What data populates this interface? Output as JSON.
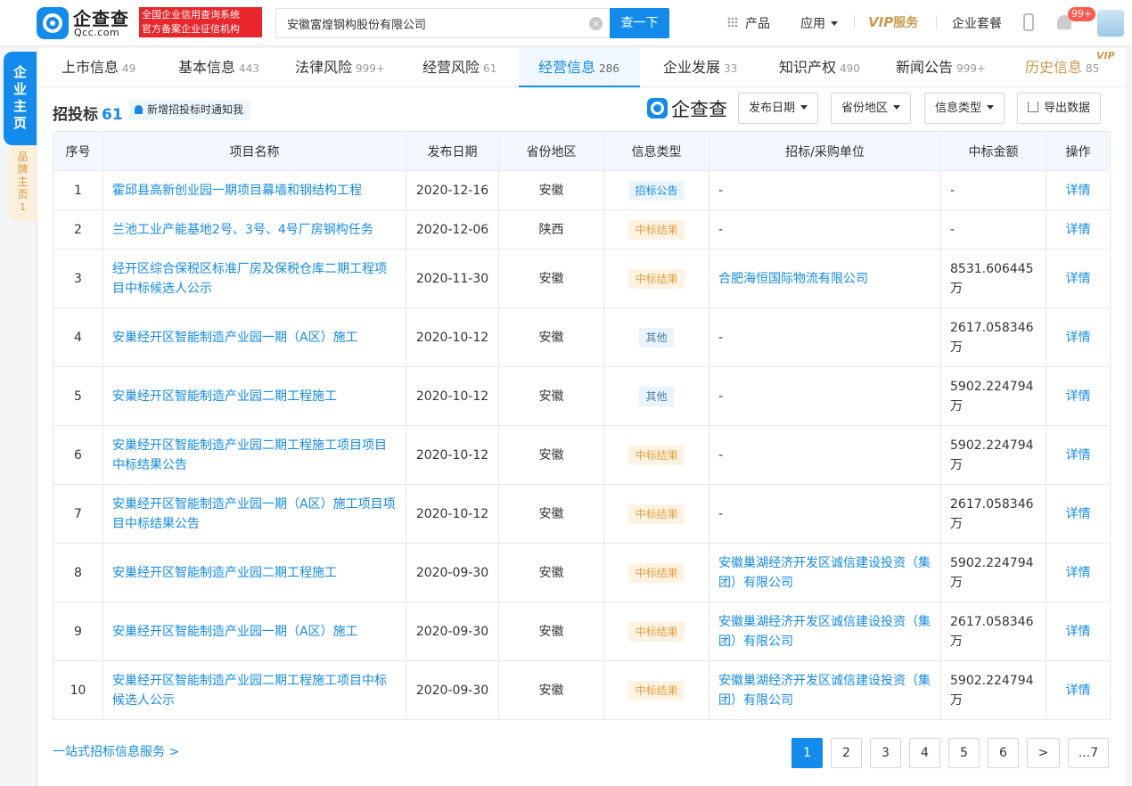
{
  "header": {
    "logo_name": "企查查",
    "logo_domain": "Qcc.com",
    "badge_line1": "全国企业信用查询系统",
    "badge_line2": "官方备案企业征信机构",
    "search_value": "安徽富煌钢构股份有限公司",
    "search_button": "查一下",
    "nav_products": "产品",
    "nav_apps": "应用",
    "nav_vip_text": "服务",
    "nav_vip_prefix": "VIP",
    "nav_package": "企业套餐",
    "notifications": "99+"
  },
  "side_tabs": {
    "main": "企业主页",
    "brand": "品牌主页",
    "brand_count": "1"
  },
  "tabs": [
    {
      "label": "上市信息",
      "count": "49"
    },
    {
      "label": "基本信息",
      "count": "443"
    },
    {
      "label": "法律风险",
      "count": "999+"
    },
    {
      "label": "经营风险",
      "count": "61"
    },
    {
      "label": "经营信息",
      "count": "286"
    },
    {
      "label": "企业发展",
      "count": "33"
    },
    {
      "label": "知识产权",
      "count": "490"
    },
    {
      "label": "新闻公告",
      "count": "999+"
    },
    {
      "label": "历史信息",
      "count": "85"
    }
  ],
  "history_vip": "VIP",
  "section": {
    "title": "招投标",
    "count": "61",
    "notify": "新增招投标时通知我",
    "brand": "企查查",
    "filters": [
      "发布日期",
      "省份地区",
      "信息类型"
    ],
    "export": "导出数据"
  },
  "table": {
    "headers": [
      "序号",
      "项目名称",
      "发布日期",
      "省份地区",
      "信息类型",
      "招标/采购单位",
      "中标金额",
      "操作"
    ],
    "rows": [
      {
        "no": "1",
        "name": "霍邱县高新创业园一期项目幕墙和钢结构工程",
        "date": "2020-12-16",
        "region": "安徽",
        "type": "招标公告",
        "unit": "-",
        "amount": "-",
        "action": "详情"
      },
      {
        "no": "2",
        "name": "兰池工业产能基地2号、3号、4号厂房钢构任务",
        "date": "2020-12-06",
        "region": "陕西",
        "type": "中标结果",
        "unit": "-",
        "amount": "-",
        "action": "详情"
      },
      {
        "no": "3",
        "name": "经开区综合保税区标准厂房及保税仓库二期工程项目中标候选人公示",
        "date": "2020-11-30",
        "region": "安徽",
        "type": "中标结果",
        "unit": "合肥海恒国际物流有限公司",
        "amount": "8531.606445万",
        "action": "详情"
      },
      {
        "no": "4",
        "name": "安巢经开区智能制造产业园一期（A区）施工",
        "date": "2020-10-12",
        "region": "安徽",
        "type": "其他",
        "unit": "-",
        "amount": "2617.058346万",
        "action": "详情"
      },
      {
        "no": "5",
        "name": "安巢经开区智能制造产业园二期工程施工",
        "date": "2020-10-12",
        "region": "安徽",
        "type": "其他",
        "unit": "-",
        "amount": "5902.224794万",
        "action": "详情"
      },
      {
        "no": "6",
        "name": "安巢经开区智能制造产业园二期工程施工项目项目中标结果公告",
        "date": "2020-10-12",
        "region": "安徽",
        "type": "中标结果",
        "unit": "-",
        "amount": "5902.224794万",
        "action": "详情"
      },
      {
        "no": "7",
        "name": "安巢经开区智能制造产业园一期（A区）施工项目项目中标结果公告",
        "date": "2020-10-12",
        "region": "安徽",
        "type": "中标结果",
        "unit": "-",
        "amount": "2617.058346万",
        "action": "详情"
      },
      {
        "no": "8",
        "name": "安巢经开区智能制造产业园二期工程施工",
        "date": "2020-09-30",
        "region": "安徽",
        "type": "中标结果",
        "unit": "安徽巢湖经济开发区诚信建设投资（集团）有限公司",
        "amount": "5902.224794万",
        "action": "详情"
      },
      {
        "no": "9",
        "name": "安巢经开区智能制造产业园一期（A区）施工",
        "date": "2020-09-30",
        "region": "安徽",
        "type": "中标结果",
        "unit": "安徽巢湖经济开发区诚信建设投资（集团）有限公司",
        "amount": "2617.058346万",
        "action": "详情"
      },
      {
        "no": "10",
        "name": "安巢经开区智能制造产业园二期工程施工项目中标候选人公示",
        "date": "2020-09-30",
        "region": "安徽",
        "type": "中标结果",
        "unit": "安徽巢湖经济开发区诚信建设投资（集团）有限公司",
        "amount": "5902.224794万",
        "action": "详情"
      }
    ]
  },
  "footer": {
    "service_link": "一站式招标信息服务 >",
    "pages": [
      "1",
      "2",
      "3",
      "4",
      "5",
      "6",
      ">",
      "...7"
    ],
    "current_page": "1"
  },
  "colors": {
    "primary": "#128bed",
    "brand_red": "#e8262b",
    "vip_gold": "#c99a4b",
    "tag_result": "#e9a23b"
  }
}
